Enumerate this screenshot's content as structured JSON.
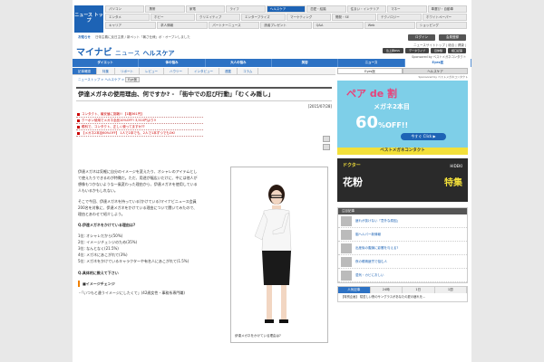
{
  "top_links": {
    "text": "運営元の株式会社マイナビ | "
  },
  "logo": {
    "text": "ニュース\nトップ"
  },
  "nav_rows": [
    [
      "パソコン",
      "携帯",
      "家電",
      "ライフ",
      "ヘルスケア",
      "恋愛・結婚",
      "住まい・インテリア",
      "マネー",
      "車選び・自動車"
    ],
    [
      "エンタメ",
      "ホビー",
      "クリエイティブ",
      "エンタープライズ",
      "マーケティング",
      "開発・SE",
      "テクノロジー",
      "ホワイトペーパー"
    ],
    [
      "キャリア",
      "求人情報",
      "パートナーニュース",
      "読者プレゼント",
      "Q&A",
      "Web",
      "ショッピング"
    ]
  ],
  "subbar": {
    "label": "お知らせ",
    "text": "日帝主義に反日主張 / 新ペット「暑さ仕様」ボ・オープンしました",
    "btn1": "ログイン",
    "btn2": "会員登録"
  },
  "header": {
    "brand": "マイナビ",
    "news": "ニュース",
    "health": "ヘルスケア",
    "links": "ニュースサイトトップ | 総合 | 健康 |",
    "btns": [
      "急上昇RSS",
      "データライブ",
      "目体験",
      "相口記事"
    ],
    "sub": "Sponsored by ベストメガネコンタクト"
  },
  "bluenav": [
    "ダイエット",
    "体の悩み",
    "大人の悩み",
    "美容",
    "ニュース",
    "Eyes医"
  ],
  "subnav": [
    "記事確認",
    "特集",
    "リポート",
    "レビュー",
    "ハウツー",
    "インタビュー",
    "連載",
    "コラム"
  ],
  "crumb": {
    "path": "ニューストップ  >  ヘルスケア  > ",
    "tag": "Eye医"
  },
  "article": {
    "title": "伊達メガネの使用理由、何ですか? - 「街中での忍び行動」「むくみ隠し」",
    "date": "[2015/07/28]",
    "promo": [
      "コンタクト、最安値に挑戦!! 【1箱361円】",
      "クーポン使用でメガネ全品10%OFF! 3,510円より!!",
      "眼科で、コンタクト、正しく使ってますか??",
      "【メガネ2本目60%OFF】 1人で2本でも、2人で1本ずつでもOK!"
    ],
    "paragraphs": [
      "伊達メガネは気軽に自分のイメージを変えたり、オシャレのアイテムとして使えたりできるのが特徴だ。ただ、用途が幅広いだけに、中には他人が想像もつかないような一風変わった理由から、伊達メガネを使用している人もいるかもしれない。",
      "そこで今回、伊達メガネを持っている(かけている)マイナビニュース会員200名を対象に、伊達メガネをかけている理由について聞いてみたので、理由とあわせて紹介しよう。"
    ],
    "q1": "Q.伊達メガネをかけている理由は?",
    "answers": [
      "1位: オシャレだから(50%)",
      "2位: イメージチェンジのため(35%)",
      "3位: なんとなく(21.5%)",
      "4位: メガネにあこがれて(3%)",
      "5位: メガネをかけているキャラクターや有名人にあこがれて(1.5%)"
    ],
    "q2": "Q.具体的に教えて下さい",
    "sec": "■イメージチェンジ",
    "quote": "・「いつもと違うイメージにしたくて」(42歳女性・事務系専門職)",
    "photo_caption": "伊達メガネをかけている理由は?"
  },
  "sidebar": {
    "tabs": [
      "Eyes医",
      "ヘルスケア"
    ],
    "sponsor": "Sponsored by ベストメガネコンタクト",
    "ad1": {
      "l1": "ペア de 割",
      "l2": "メガネ2本目",
      "l3": "60",
      "l3b": "%OFF!!",
      "btn": "今すぐ Click ▶",
      "foot": "ベストメガネコンタクト"
    },
    "ad2": {
      "t1": "ドクター",
      "t2": "花粉",
      "t3": "HIDEKI",
      "t4": "特集"
    },
    "feed_head": "注目記事",
    "feed": [
      "疲れが抜けない「意外な原因」",
      "脳ヘルパー新情報",
      "出産後の腹膜に影響を与える?",
      "夜の眼精疲労で悩む人",
      "湿気・カビにおしい"
    ],
    "rank_tabs": [
      "人気記事",
      "24時",
      "1日",
      "1週"
    ],
    "rank_item": "【特別企画】 寝苦しい夜のサングラスがあなたの夏の疲れを…"
  }
}
